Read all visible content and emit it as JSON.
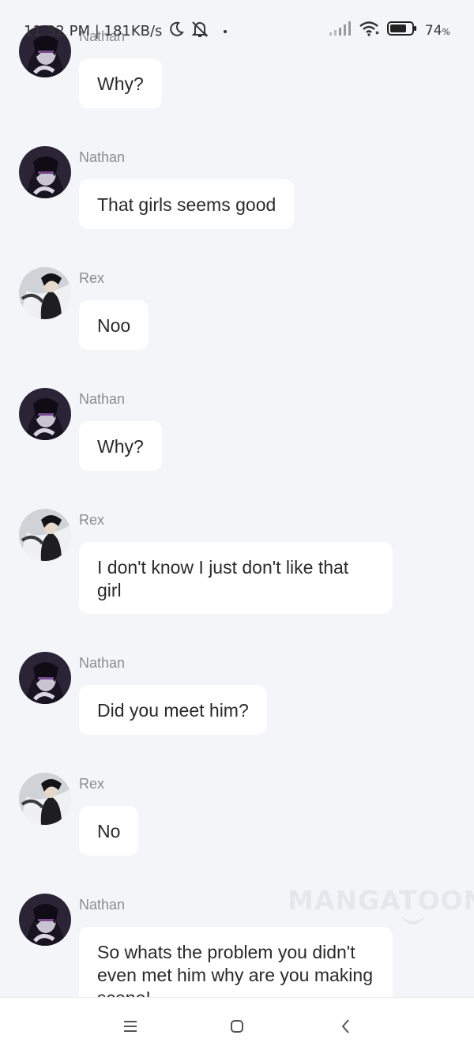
{
  "status_bar": {
    "time_speed": "11:32 PM | 181KB/s",
    "battery": "74",
    "battery_unit": "%",
    "icons": [
      "moon-icon",
      "bell-muted-icon",
      "signal-icon",
      "wifi-icon",
      "battery-icon"
    ]
  },
  "messages": [
    {
      "sender": "Nathan",
      "text": "Why?"
    },
    {
      "sender": "Nathan",
      "text": "That girls seems good"
    },
    {
      "sender": "Rex",
      "text": "Noo"
    },
    {
      "sender": "Nathan",
      "text": "Why?"
    },
    {
      "sender": "Rex",
      "text": "I don't know I just don't like that girl"
    },
    {
      "sender": "Nathan",
      "text": "Did you meet him?"
    },
    {
      "sender": "Rex",
      "text": "No"
    },
    {
      "sender": "Nathan",
      "text": "So whats the problem you didn't even met him why are you making scene!"
    }
  ],
  "watermark": "MANGATOON",
  "nav_bar": {
    "icons": [
      "menu-icon",
      "home-icon",
      "back-icon"
    ]
  },
  "colors": {
    "background": "#f4f5f9",
    "bubble": "#ffffff",
    "name_text": "#8c8c8c"
  }
}
